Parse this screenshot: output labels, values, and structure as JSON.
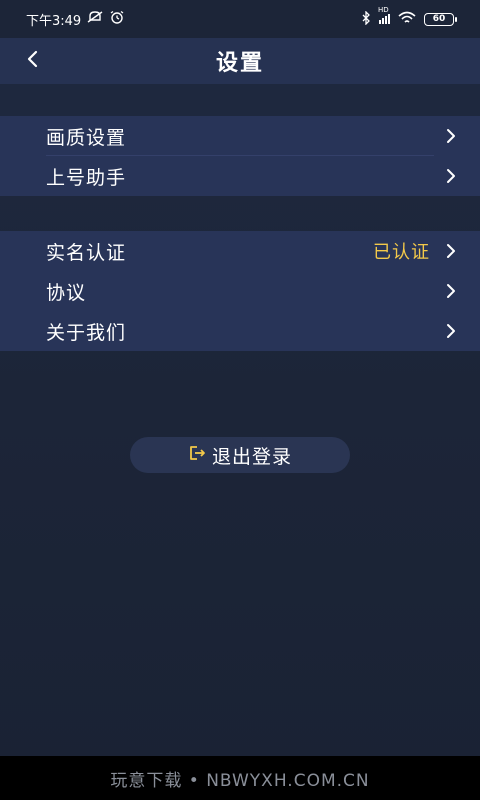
{
  "status_bar": {
    "time": "下午3:49",
    "network_label": "HD",
    "battery_level": "60"
  },
  "header": {
    "title": "设置",
    "back_icon": "chevron-left-icon"
  },
  "groups": [
    {
      "items": [
        {
          "label": "画质设置",
          "value": ""
        },
        {
          "label": "上号助手",
          "value": ""
        }
      ]
    },
    {
      "items": [
        {
          "label": "实名认证",
          "value": "已认证"
        },
        {
          "label": "协议",
          "value": ""
        },
        {
          "label": "关于我们",
          "value": ""
        }
      ]
    }
  ],
  "logout": {
    "label": "退出登录",
    "icon": "logout-icon",
    "icon_color": "#f3c94a"
  },
  "watermark": {
    "text": "玩意下载 • NBWYXH.COM.CN"
  },
  "colors": {
    "accent": "#f3c94a",
    "background": "#1c2538",
    "row_background": "#283458",
    "header_background": "#263252"
  }
}
